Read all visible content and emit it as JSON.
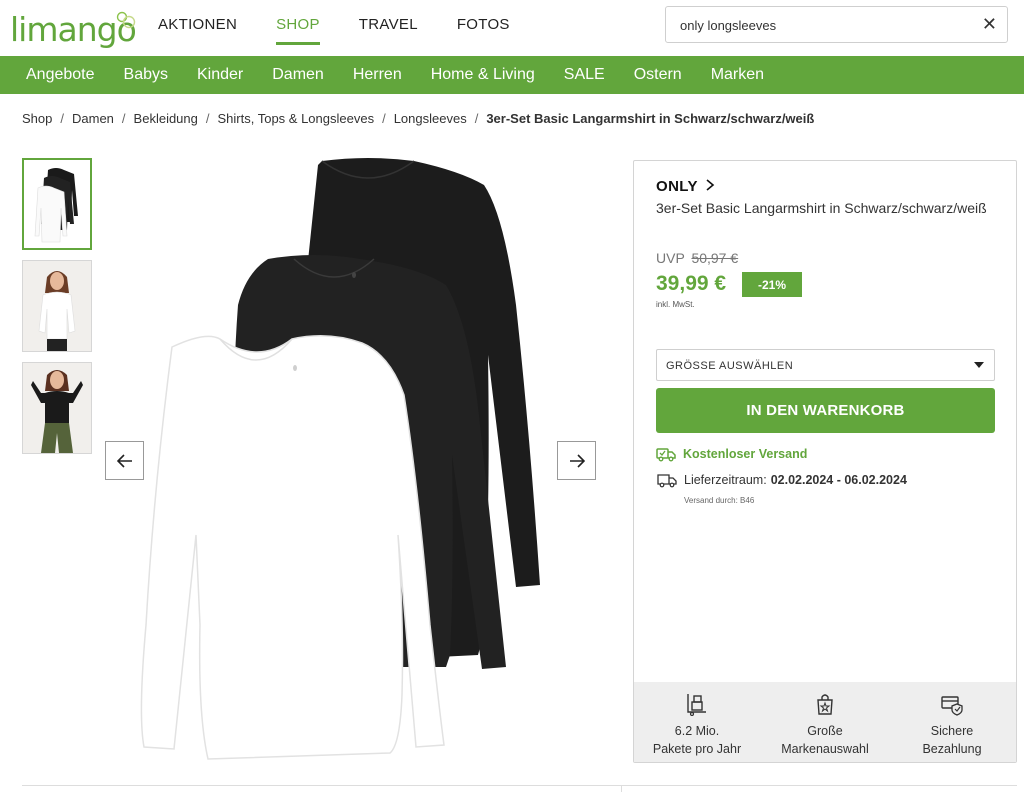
{
  "header": {
    "logo_text": "limango",
    "nav": [
      "AKTIONEN",
      "SHOP",
      "TRAVEL",
      "FOTOS"
    ],
    "active_nav": "SHOP",
    "search_value": "only longsleeves",
    "accent_color": "#62a63c"
  },
  "categories": [
    "Angebote",
    "Babys",
    "Kinder",
    "Damen",
    "Herren",
    "Home & Living",
    "SALE",
    "Ostern",
    "Marken"
  ],
  "breadcrumb": [
    "Shop",
    "Damen",
    "Bekleidung",
    "Shirts, Tops & Longsleeves",
    "Longsleeves",
    "3er-Set Basic Langarmshirt in Schwarz/schwarz/weiß"
  ],
  "product": {
    "brand": "ONLY",
    "title": "3er-Set Basic Langarmshirt in Schwarz/schwarz/weiß",
    "uvp_label": "UVP",
    "uvp_price": "50,97 €",
    "price": "39,99 €",
    "discount": "-21%",
    "tax_note": "inkl. MwSt.",
    "size_select": "GRÖSSE AUSWÄHLEN",
    "cart_button": "IN DEN WARENKORB",
    "shipping": "Kostenloser Versand",
    "delivery_label": "Lieferzeitraum:",
    "delivery_dates": "02.02.2024 - 06.02.2024",
    "vendor": "Versand durch: B46"
  },
  "features": [
    {
      "icon": "package-icon",
      "line1": "6.2 Mio.",
      "line2": "Pakete pro Jahr"
    },
    {
      "icon": "shopping-bag-icon",
      "line1": "Große",
      "line2": "Markenauswahl"
    },
    {
      "icon": "secure-payment-icon",
      "line1": "Sichere",
      "line2": "Bezahlung"
    }
  ]
}
